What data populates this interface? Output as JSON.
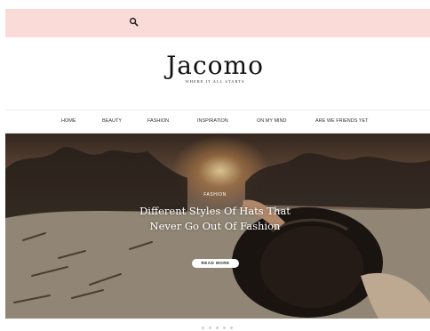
{
  "site": {
    "title": "Jacomo",
    "tagline": "WHERE IT ALL STARTS"
  },
  "topbar": {
    "search_icon": "search-icon",
    "background": "#fadbd8"
  },
  "nav": {
    "items": [
      {
        "label": "HOME"
      },
      {
        "label": "BEAUTY"
      },
      {
        "label": "FASHION"
      },
      {
        "label": "INSPIRATION"
      },
      {
        "label": "ON MY MIND"
      },
      {
        "label": "ARE WE FRIENDS YET"
      }
    ]
  },
  "hero": {
    "category": "FASHION",
    "title": "Different Styles Of Hats That Never Go Out Of Fashion",
    "button": "READ MORE"
  },
  "slider": {
    "dot_count": 5
  }
}
